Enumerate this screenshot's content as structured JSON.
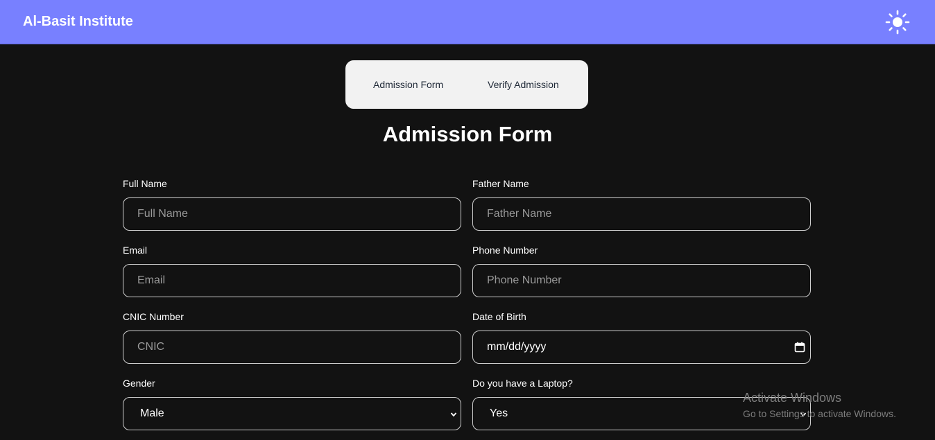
{
  "header": {
    "brand": "Al-Basit Institute",
    "theme_icon": "sun-icon",
    "background": "#7880ff"
  },
  "tabs": [
    {
      "label": "Admission Form"
    },
    {
      "label": "Verify Admission"
    }
  ],
  "form": {
    "title": "Admission Form",
    "fields": {
      "full_name": {
        "label": "Full Name",
        "placeholder": "Full Name"
      },
      "father_name": {
        "label": "Father Name",
        "placeholder": "Father Name"
      },
      "email": {
        "label": "Email",
        "placeholder": "Email"
      },
      "phone": {
        "label": "Phone Number",
        "placeholder": "Phone Number"
      },
      "cnic": {
        "label": "CNIC Number",
        "placeholder": "CNIC"
      },
      "dob": {
        "label": "Date of Birth",
        "value": "mm/dd/yyyy",
        "icon": "calendar-icon"
      },
      "gender": {
        "label": "Gender",
        "value": "Male",
        "icon": "chevron-down-icon"
      },
      "laptop": {
        "label": "Do you have a Laptop?",
        "value": "Yes",
        "icon": "chevron-down-icon"
      }
    }
  },
  "watermark": {
    "line1": "Activate Windows",
    "line2": "Go to Settings to activate Windows."
  }
}
